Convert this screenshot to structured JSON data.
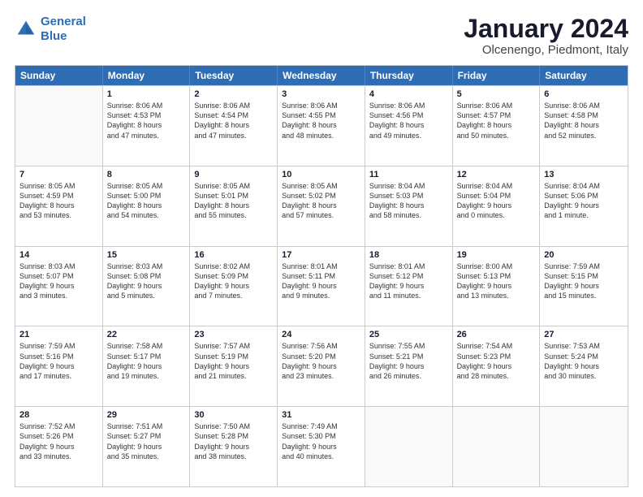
{
  "logo": {
    "line1": "General",
    "line2": "Blue"
  },
  "title": "January 2024",
  "subtitle": "Olcenengo, Piedmont, Italy",
  "header_days": [
    "Sunday",
    "Monday",
    "Tuesday",
    "Wednesday",
    "Thursday",
    "Friday",
    "Saturday"
  ],
  "rows": [
    [
      {
        "day": "",
        "lines": [],
        "empty": true
      },
      {
        "day": "1",
        "lines": [
          "Sunrise: 8:06 AM",
          "Sunset: 4:53 PM",
          "Daylight: 8 hours",
          "and 47 minutes."
        ]
      },
      {
        "day": "2",
        "lines": [
          "Sunrise: 8:06 AM",
          "Sunset: 4:54 PM",
          "Daylight: 8 hours",
          "and 47 minutes."
        ]
      },
      {
        "day": "3",
        "lines": [
          "Sunrise: 8:06 AM",
          "Sunset: 4:55 PM",
          "Daylight: 8 hours",
          "and 48 minutes."
        ]
      },
      {
        "day": "4",
        "lines": [
          "Sunrise: 8:06 AM",
          "Sunset: 4:56 PM",
          "Daylight: 8 hours",
          "and 49 minutes."
        ]
      },
      {
        "day": "5",
        "lines": [
          "Sunrise: 8:06 AM",
          "Sunset: 4:57 PM",
          "Daylight: 8 hours",
          "and 50 minutes."
        ]
      },
      {
        "day": "6",
        "lines": [
          "Sunrise: 8:06 AM",
          "Sunset: 4:58 PM",
          "Daylight: 8 hours",
          "and 52 minutes."
        ]
      }
    ],
    [
      {
        "day": "7",
        "lines": [
          "Sunrise: 8:05 AM",
          "Sunset: 4:59 PM",
          "Daylight: 8 hours",
          "and 53 minutes."
        ]
      },
      {
        "day": "8",
        "lines": [
          "Sunrise: 8:05 AM",
          "Sunset: 5:00 PM",
          "Daylight: 8 hours",
          "and 54 minutes."
        ]
      },
      {
        "day": "9",
        "lines": [
          "Sunrise: 8:05 AM",
          "Sunset: 5:01 PM",
          "Daylight: 8 hours",
          "and 55 minutes."
        ]
      },
      {
        "day": "10",
        "lines": [
          "Sunrise: 8:05 AM",
          "Sunset: 5:02 PM",
          "Daylight: 8 hours",
          "and 57 minutes."
        ]
      },
      {
        "day": "11",
        "lines": [
          "Sunrise: 8:04 AM",
          "Sunset: 5:03 PM",
          "Daylight: 8 hours",
          "and 58 minutes."
        ]
      },
      {
        "day": "12",
        "lines": [
          "Sunrise: 8:04 AM",
          "Sunset: 5:04 PM",
          "Daylight: 9 hours",
          "and 0 minutes."
        ]
      },
      {
        "day": "13",
        "lines": [
          "Sunrise: 8:04 AM",
          "Sunset: 5:06 PM",
          "Daylight: 9 hours",
          "and 1 minute."
        ]
      }
    ],
    [
      {
        "day": "14",
        "lines": [
          "Sunrise: 8:03 AM",
          "Sunset: 5:07 PM",
          "Daylight: 9 hours",
          "and 3 minutes."
        ]
      },
      {
        "day": "15",
        "lines": [
          "Sunrise: 8:03 AM",
          "Sunset: 5:08 PM",
          "Daylight: 9 hours",
          "and 5 minutes."
        ]
      },
      {
        "day": "16",
        "lines": [
          "Sunrise: 8:02 AM",
          "Sunset: 5:09 PM",
          "Daylight: 9 hours",
          "and 7 minutes."
        ]
      },
      {
        "day": "17",
        "lines": [
          "Sunrise: 8:01 AM",
          "Sunset: 5:11 PM",
          "Daylight: 9 hours",
          "and 9 minutes."
        ]
      },
      {
        "day": "18",
        "lines": [
          "Sunrise: 8:01 AM",
          "Sunset: 5:12 PM",
          "Daylight: 9 hours",
          "and 11 minutes."
        ]
      },
      {
        "day": "19",
        "lines": [
          "Sunrise: 8:00 AM",
          "Sunset: 5:13 PM",
          "Daylight: 9 hours",
          "and 13 minutes."
        ]
      },
      {
        "day": "20",
        "lines": [
          "Sunrise: 7:59 AM",
          "Sunset: 5:15 PM",
          "Daylight: 9 hours",
          "and 15 minutes."
        ]
      }
    ],
    [
      {
        "day": "21",
        "lines": [
          "Sunrise: 7:59 AM",
          "Sunset: 5:16 PM",
          "Daylight: 9 hours",
          "and 17 minutes."
        ]
      },
      {
        "day": "22",
        "lines": [
          "Sunrise: 7:58 AM",
          "Sunset: 5:17 PM",
          "Daylight: 9 hours",
          "and 19 minutes."
        ]
      },
      {
        "day": "23",
        "lines": [
          "Sunrise: 7:57 AM",
          "Sunset: 5:19 PM",
          "Daylight: 9 hours",
          "and 21 minutes."
        ]
      },
      {
        "day": "24",
        "lines": [
          "Sunrise: 7:56 AM",
          "Sunset: 5:20 PM",
          "Daylight: 9 hours",
          "and 23 minutes."
        ]
      },
      {
        "day": "25",
        "lines": [
          "Sunrise: 7:55 AM",
          "Sunset: 5:21 PM",
          "Daylight: 9 hours",
          "and 26 minutes."
        ]
      },
      {
        "day": "26",
        "lines": [
          "Sunrise: 7:54 AM",
          "Sunset: 5:23 PM",
          "Daylight: 9 hours",
          "and 28 minutes."
        ]
      },
      {
        "day": "27",
        "lines": [
          "Sunrise: 7:53 AM",
          "Sunset: 5:24 PM",
          "Daylight: 9 hours",
          "and 30 minutes."
        ]
      }
    ],
    [
      {
        "day": "28",
        "lines": [
          "Sunrise: 7:52 AM",
          "Sunset: 5:26 PM",
          "Daylight: 9 hours",
          "and 33 minutes."
        ]
      },
      {
        "day": "29",
        "lines": [
          "Sunrise: 7:51 AM",
          "Sunset: 5:27 PM",
          "Daylight: 9 hours",
          "and 35 minutes."
        ]
      },
      {
        "day": "30",
        "lines": [
          "Sunrise: 7:50 AM",
          "Sunset: 5:28 PM",
          "Daylight: 9 hours",
          "and 38 minutes."
        ]
      },
      {
        "day": "31",
        "lines": [
          "Sunrise: 7:49 AM",
          "Sunset: 5:30 PM",
          "Daylight: 9 hours",
          "and 40 minutes."
        ]
      },
      {
        "day": "",
        "lines": [],
        "empty": true
      },
      {
        "day": "",
        "lines": [],
        "empty": true
      },
      {
        "day": "",
        "lines": [],
        "empty": true
      }
    ]
  ]
}
